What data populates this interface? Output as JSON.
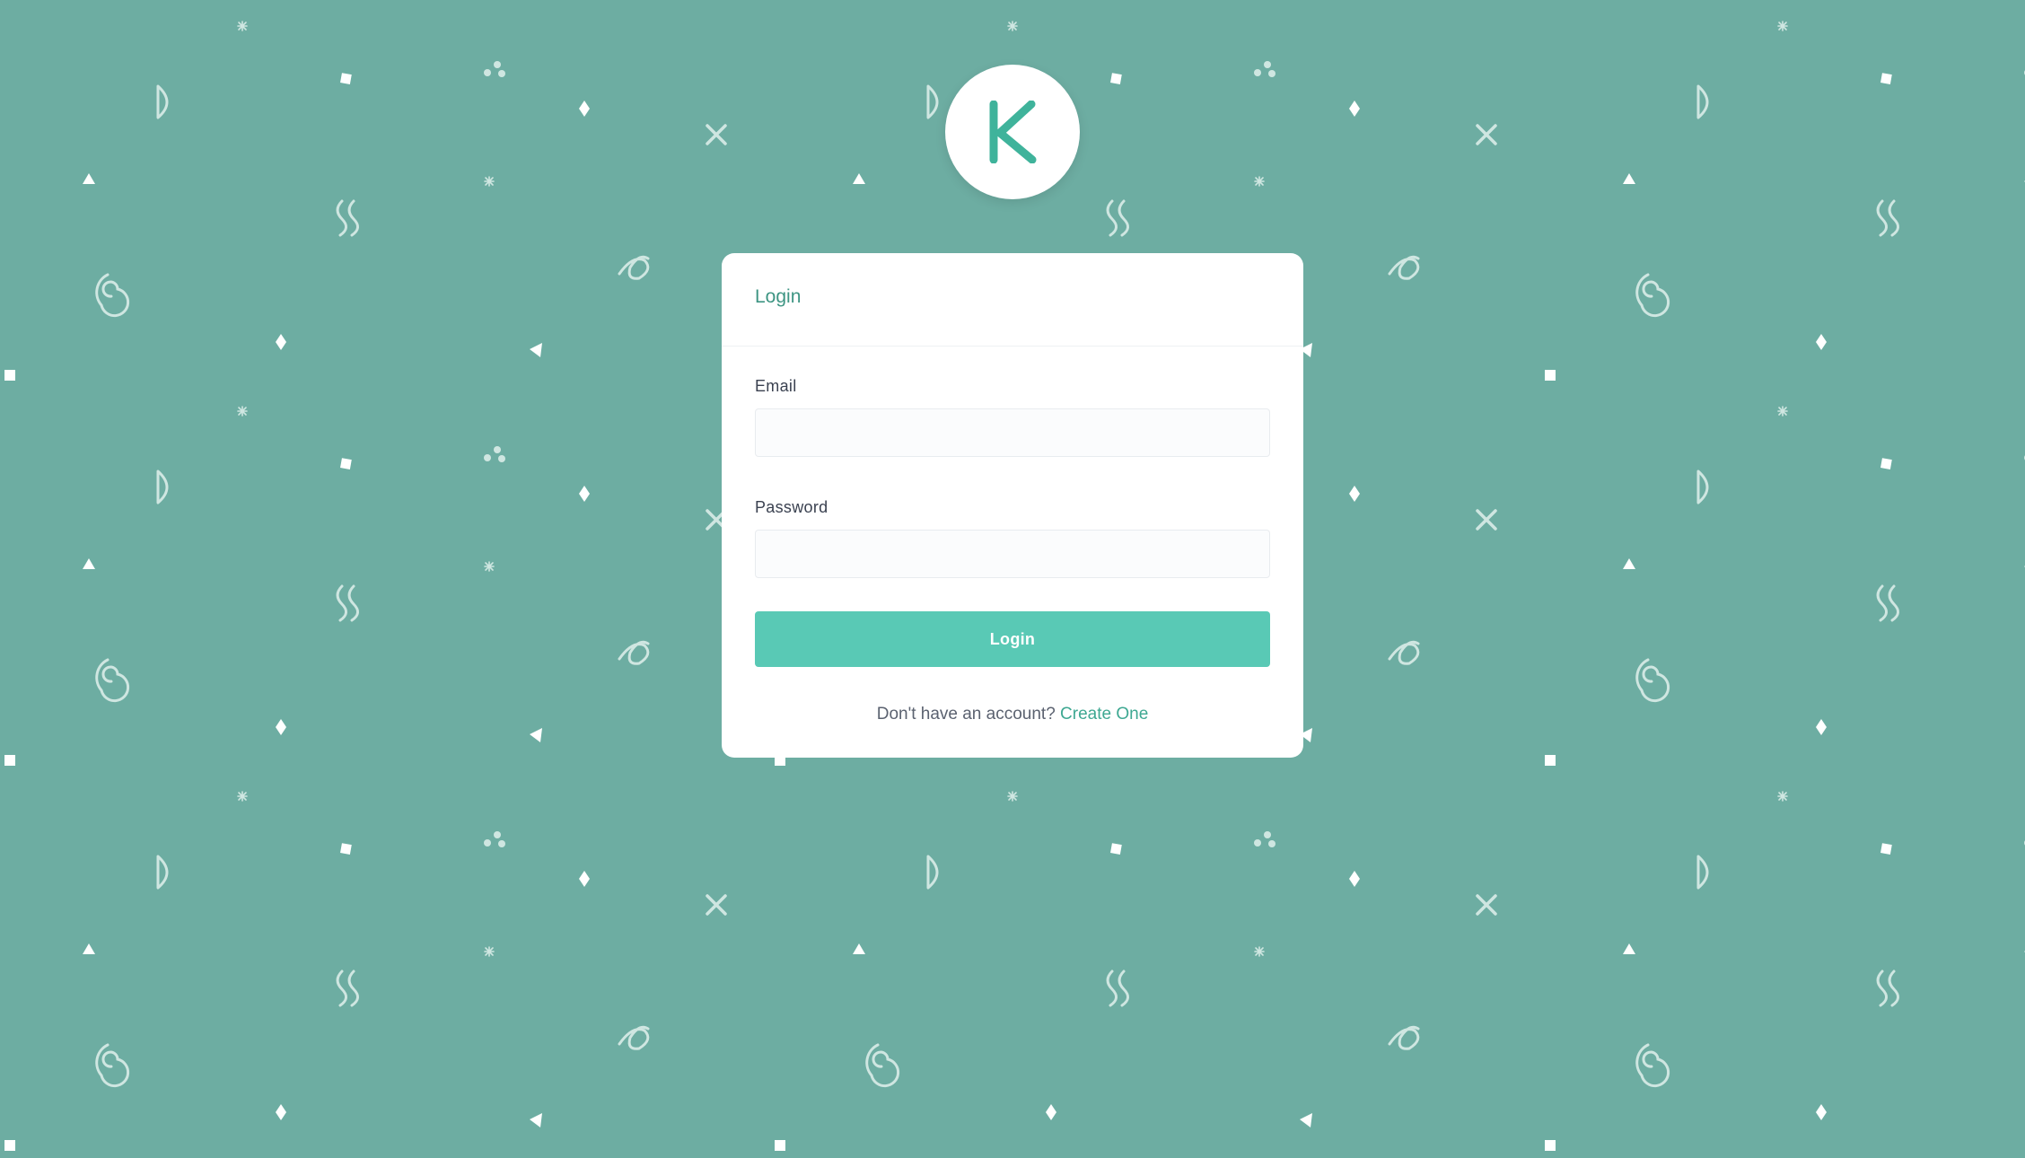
{
  "colors": {
    "background": "#6dada2",
    "accent": "#59c9b5",
    "title": "#3e9583",
    "link": "#3ea892"
  },
  "logo": {
    "letter": "K",
    "icon": "k-logo-icon"
  },
  "login_card": {
    "title": "Login",
    "email_label": "Email",
    "email_value": "",
    "email_placeholder": "",
    "password_label": "Password",
    "password_value": "",
    "password_placeholder": "",
    "submit_label": "Login",
    "signup_prompt": "Don't have an account?",
    "signup_link": "Create One"
  }
}
